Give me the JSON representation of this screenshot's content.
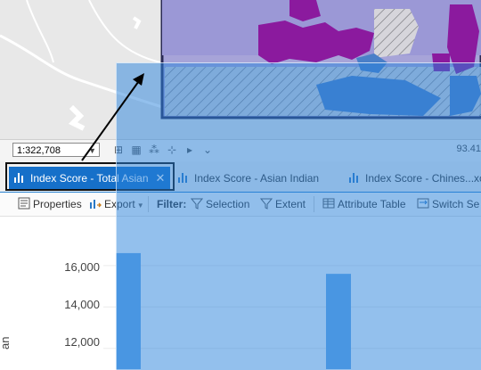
{
  "map": {
    "scale": "1:322,708",
    "coordinates": "93.41"
  },
  "tabs": [
    {
      "label": "Index Score - Total Asian",
      "active": true
    },
    {
      "label": "Index Score - Asian Indian",
      "active": false
    },
    {
      "label": "Index Score - Chines...xc",
      "active": false
    }
  ],
  "toolbar": {
    "properties": "Properties",
    "export": "Export",
    "filter": "Filter:",
    "selection": "Selection",
    "extent": "Extent",
    "attribute_table": "Attribute Table",
    "switch_selection": "Switch Se"
  },
  "icons": {
    "chart_tab": "bar-chart-icon",
    "close": "close-icon",
    "properties": "properties-icon",
    "export": "export-icon",
    "selection_filter": "filter-selection-icon",
    "extent_filter": "filter-extent-icon",
    "attribute_table": "table-icon",
    "switch_selection": "switch-selection-icon"
  },
  "colors": {
    "active_tab": "#1670c9",
    "highlight_overlay": "#2882dc",
    "bar": "#6aabe8",
    "map_purple": "#8b1a9e",
    "map_lavender": "#9b98d6"
  },
  "chart_data": {
    "type": "bar",
    "ylabel": "an",
    "yticks": [
      "16,000",
      "14,000",
      "12,000"
    ],
    "ylim_visible": [
      11000,
      17500
    ],
    "values_visible_tops": [
      16600,
      15600
    ]
  }
}
